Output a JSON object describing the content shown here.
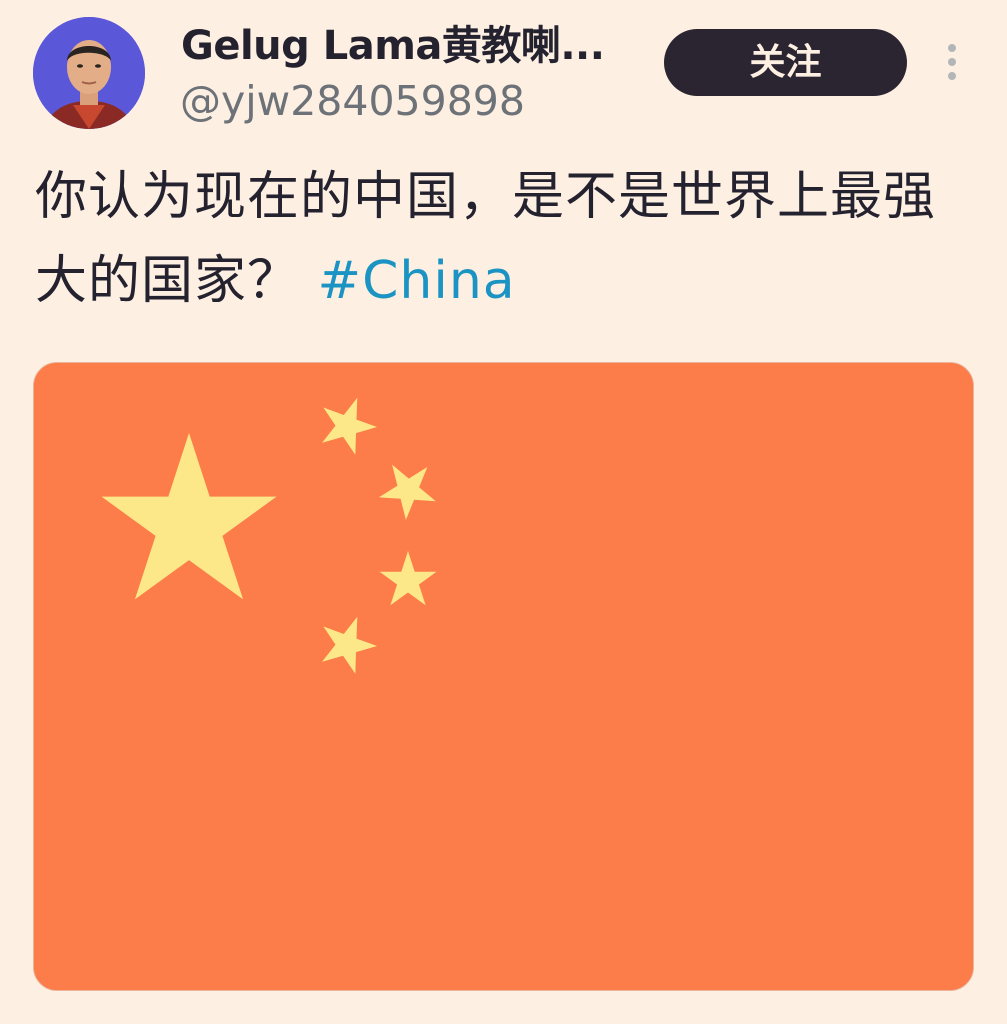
{
  "tweet": {
    "author": {
      "display_name": "Gelug Lama黄教喇...",
      "handle": "@yjw284059898",
      "avatar_icon": "person-portrait-avatar"
    },
    "follow_label": "关注",
    "more_icon": "vertical-ellipsis-icon",
    "text": "你认为现在的中国，是不是世界上最强大的国家？ ",
    "hashtag": "#China",
    "media": {
      "description_icon": "flag-of-china-image",
      "flag_color": "#fd7d4a",
      "star_color": "#fde889"
    }
  },
  "colors": {
    "background": "#fdefe2",
    "text": "#24222f",
    "secondary_text": "#6c7278",
    "link": "#1b93c3",
    "button_bg": "#2a2531"
  }
}
